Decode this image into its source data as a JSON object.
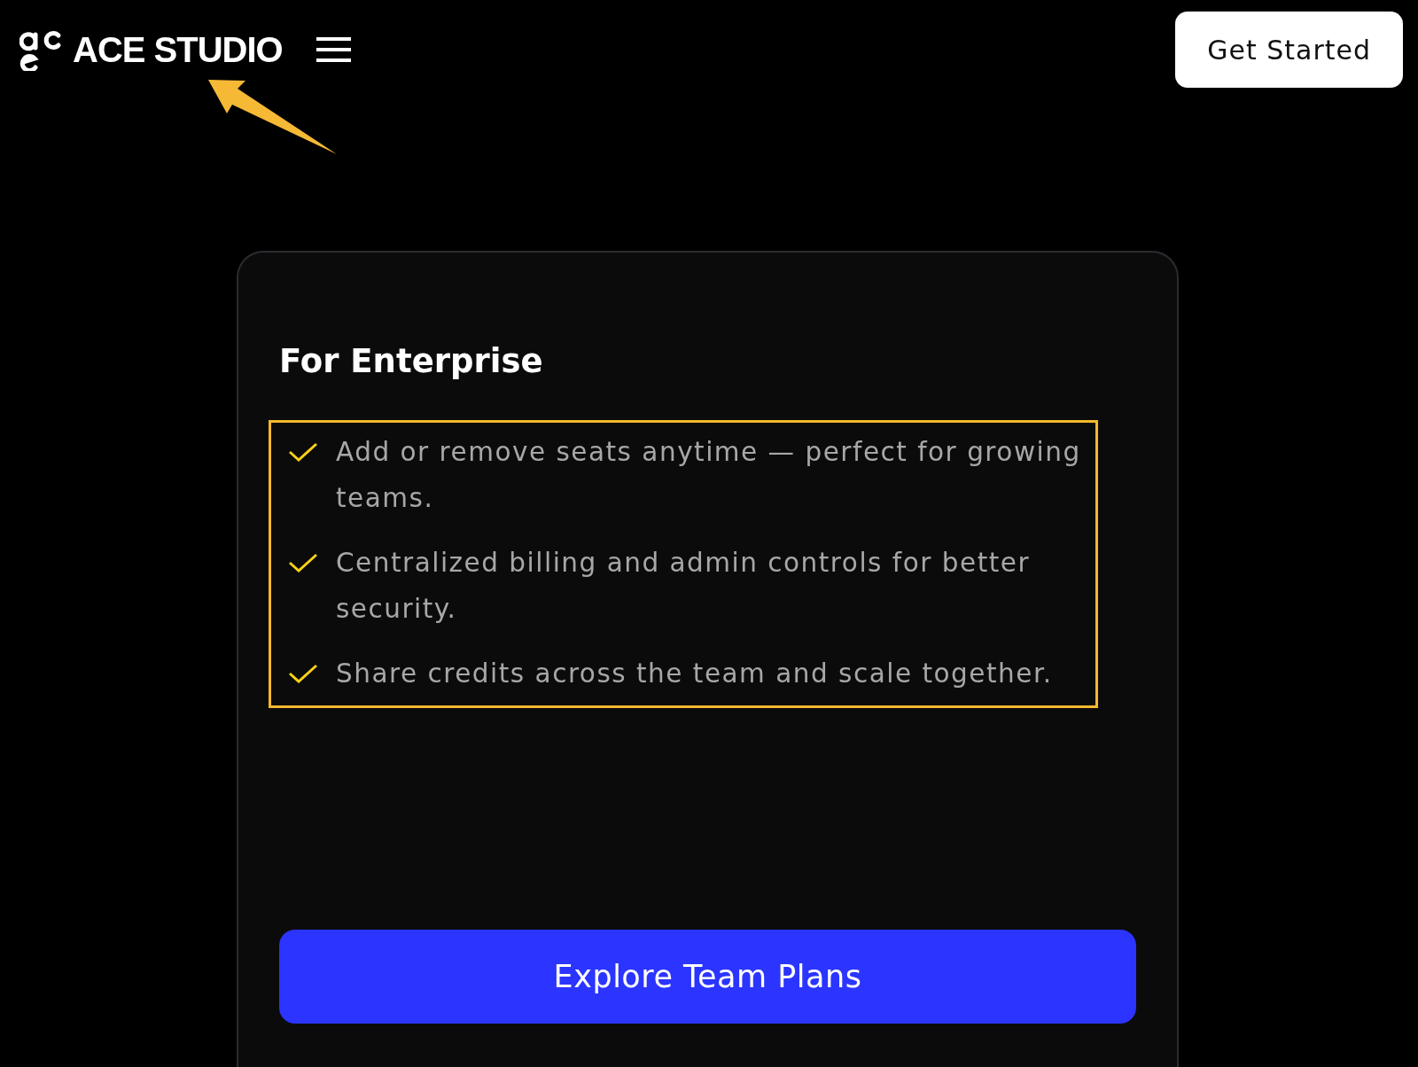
{
  "header": {
    "logo_text": "ACE STUDIO",
    "cta_button": "Get Started"
  },
  "card": {
    "title": "For Enterprise",
    "features": [
      "Add or remove seats anytime — perfect for growing teams.",
      "Centralized billing and admin controls for better security.",
      "Share credits across the team and scale together."
    ],
    "button": "Explore Team Plans"
  },
  "annotations": {
    "logo_arrow": true,
    "features_box": true
  }
}
